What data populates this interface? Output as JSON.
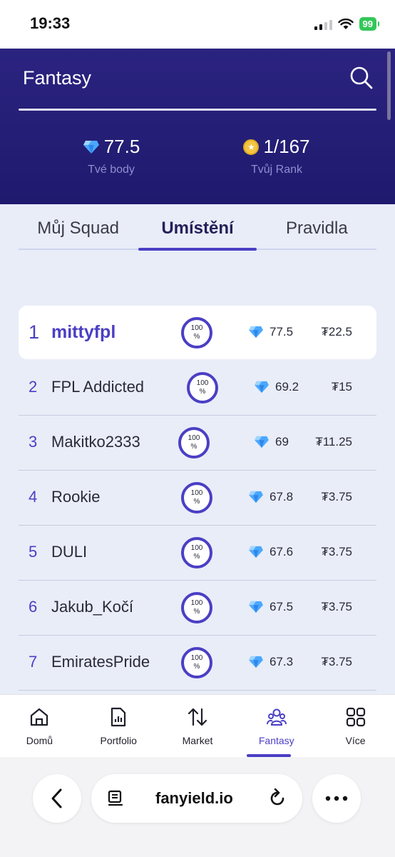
{
  "status": {
    "time": "19:33",
    "battery": "99"
  },
  "header": {
    "title": "Fantasy",
    "points_value": "77.5",
    "points_label": "Tvé body",
    "rank_value": "1/167",
    "rank_label": "Tvůj Rank"
  },
  "tabs": [
    {
      "label": "Můj Squad",
      "active": false
    },
    {
      "label": "Umístění",
      "active": true
    },
    {
      "label": "Pravidla",
      "active": false
    }
  ],
  "leaderboard": [
    {
      "rank": "1",
      "name": "mittyfpl",
      "pct_top": "100",
      "pct_bottom": "%",
      "points": "77.5",
      "tokens": "₮22.5"
    },
    {
      "rank": "2",
      "name": "FPL Addicted",
      "pct_top": "100",
      "pct_bottom": "%",
      "points": "69.2",
      "tokens": "₮15"
    },
    {
      "rank": "3",
      "name": "Makitko2333",
      "pct_top": "100",
      "pct_bottom": "%",
      "points": "69",
      "tokens": "₮11.25"
    },
    {
      "rank": "4",
      "name": "Rookie",
      "pct_top": "100",
      "pct_bottom": "%",
      "points": "67.8",
      "tokens": "₮3.75"
    },
    {
      "rank": "5",
      "name": "DULI",
      "pct_top": "100",
      "pct_bottom": "%",
      "points": "67.6",
      "tokens": "₮3.75"
    },
    {
      "rank": "6",
      "name": "Jakub_Kočí",
      "pct_top": "100",
      "pct_bottom": "%",
      "points": "67.5",
      "tokens": "₮3.75"
    },
    {
      "rank": "7",
      "name": "EmiratesPride",
      "pct_top": "100",
      "pct_bottom": "%",
      "points": "67.3",
      "tokens": "₮3.75"
    }
  ],
  "nav": [
    {
      "label": "Domů",
      "icon": "home-icon"
    },
    {
      "label": "Portfolio",
      "icon": "portfolio-icon"
    },
    {
      "label": "Market",
      "icon": "market-icon"
    },
    {
      "label": "Fantasy",
      "icon": "fantasy-icon",
      "active": true
    },
    {
      "label": "Více",
      "icon": "more-grid-icon"
    }
  ],
  "browser": {
    "url": "fanyield.io"
  },
  "colors": {
    "header_bg": "#2b2380",
    "accent": "#4b3fc4",
    "page_bg": "#e9edf8"
  }
}
